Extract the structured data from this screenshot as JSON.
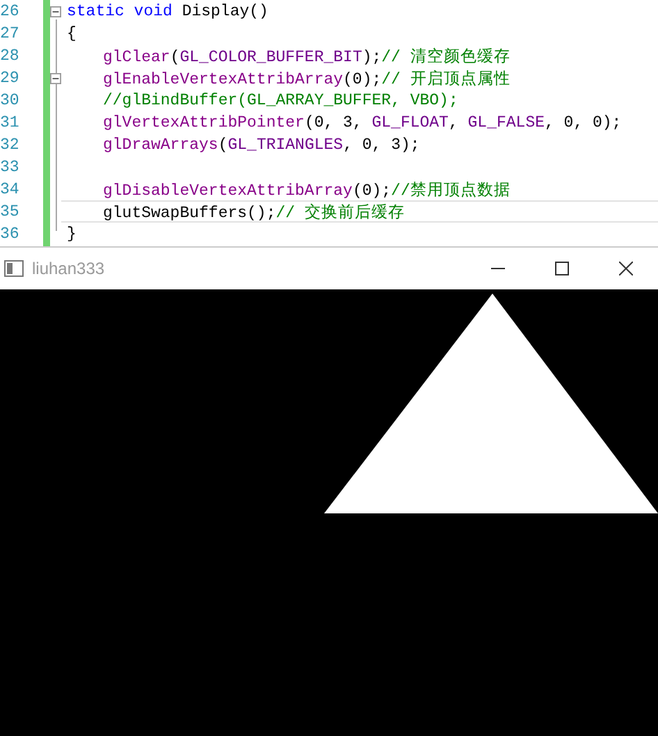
{
  "editor": {
    "lines": [
      {
        "number": "26",
        "fold": true,
        "indented": false,
        "current": false,
        "tokens": [
          {
            "kind": "keyword",
            "text": "static void"
          },
          {
            "kind": "plain",
            "text": " Display()"
          }
        ]
      },
      {
        "number": "27",
        "fold": false,
        "indented": false,
        "current": false,
        "tokens": [
          {
            "kind": "plain",
            "text": "{"
          }
        ]
      },
      {
        "number": "28",
        "fold": false,
        "indented": true,
        "current": false,
        "tokens": [
          {
            "kind": "func",
            "text": "glClear"
          },
          {
            "kind": "plain",
            "text": "("
          },
          {
            "kind": "macro",
            "text": "GL_COLOR_BUFFER_BIT"
          },
          {
            "kind": "plain",
            "text": ");"
          },
          {
            "kind": "comment",
            "text": "// 清空颜色缓存"
          }
        ]
      },
      {
        "number": "29",
        "fold": true,
        "indented": true,
        "current": false,
        "tokens": [
          {
            "kind": "func",
            "text": "glEnableVertexAttribArray"
          },
          {
            "kind": "plain",
            "text": "(0);"
          },
          {
            "kind": "comment",
            "text": "// 开启顶点属性"
          }
        ]
      },
      {
        "number": "30",
        "fold": false,
        "indented": true,
        "current": false,
        "tokens": [
          {
            "kind": "comment",
            "text": "//glBindBuffer(GL_ARRAY_BUFFER, VBO);"
          }
        ]
      },
      {
        "number": "31",
        "fold": false,
        "indented": true,
        "current": false,
        "tokens": [
          {
            "kind": "func",
            "text": "glVertexAttribPointer"
          },
          {
            "kind": "plain",
            "text": "(0, 3, "
          },
          {
            "kind": "macro",
            "text": "GL_FLOAT"
          },
          {
            "kind": "plain",
            "text": ", "
          },
          {
            "kind": "macro",
            "text": "GL_FALSE"
          },
          {
            "kind": "plain",
            "text": ", 0, 0);"
          }
        ]
      },
      {
        "number": "32",
        "fold": false,
        "indented": true,
        "current": false,
        "tokens": [
          {
            "kind": "func",
            "text": "glDrawArrays"
          },
          {
            "kind": "plain",
            "text": "("
          },
          {
            "kind": "macro",
            "text": "GL_TRIANGLES"
          },
          {
            "kind": "plain",
            "text": ", 0, 3);"
          }
        ]
      },
      {
        "number": "33",
        "fold": false,
        "current": false
      },
      {
        "number": "34",
        "fold": false,
        "indented": true,
        "current": false,
        "tokens": [
          {
            "kind": "func",
            "text": "glDisableVertexAttribArray"
          },
          {
            "kind": "plain",
            "text": "(0);"
          },
          {
            "kind": "comment",
            "text": "//禁用顶点数据"
          }
        ]
      },
      {
        "number": "35",
        "fold": false,
        "indented": true,
        "current": true,
        "tokens": [
          {
            "kind": "plain",
            "text": "glutSwapBuffers();"
          },
          {
            "kind": "comment",
            "text": "// 交换前后缓存"
          }
        ]
      },
      {
        "number": "36",
        "fold": false,
        "indented": false,
        "current": false,
        "tokens": [
          {
            "kind": "plain",
            "text": "}"
          }
        ]
      }
    ]
  },
  "window": {
    "title": "liuhan333"
  }
}
